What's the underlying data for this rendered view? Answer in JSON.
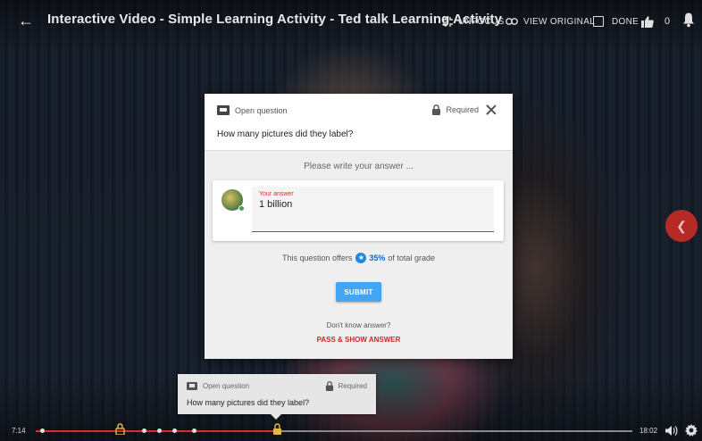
{
  "topbar": {
    "title": "Interactive Video - Simple Learning Activity - Ted talk Learning Activity",
    "unfocus_label": "UNFOCUS",
    "view_original_label": "VIEW ORIGINAL",
    "done_label": "DONE",
    "like_count": "0"
  },
  "modal": {
    "question_type": "Open question",
    "required_label": "Required",
    "question": "How many pictures did they label?",
    "prompt": "Please write your answer ...",
    "answer_label": "Your answer",
    "answer_value": "1 billion",
    "grade_prefix": "This question offers",
    "grade_percent": "35%",
    "grade_suffix": "of total grade",
    "submit_label": "SUBMIT",
    "dont_know": "Don't know answer?",
    "pass_label": "PASS & SHOW ANSWER"
  },
  "mini_card": {
    "question_type": "Open question",
    "required_label": "Required",
    "question": "How many pictures did they label?"
  },
  "player": {
    "current_time": "7:14",
    "total_time": "18:02",
    "progress_fraction": 0.4
  },
  "colors": {
    "accent_red": "#d32f2f",
    "submit_blue": "#42a5f5",
    "grade_blue": "#1565c0"
  }
}
